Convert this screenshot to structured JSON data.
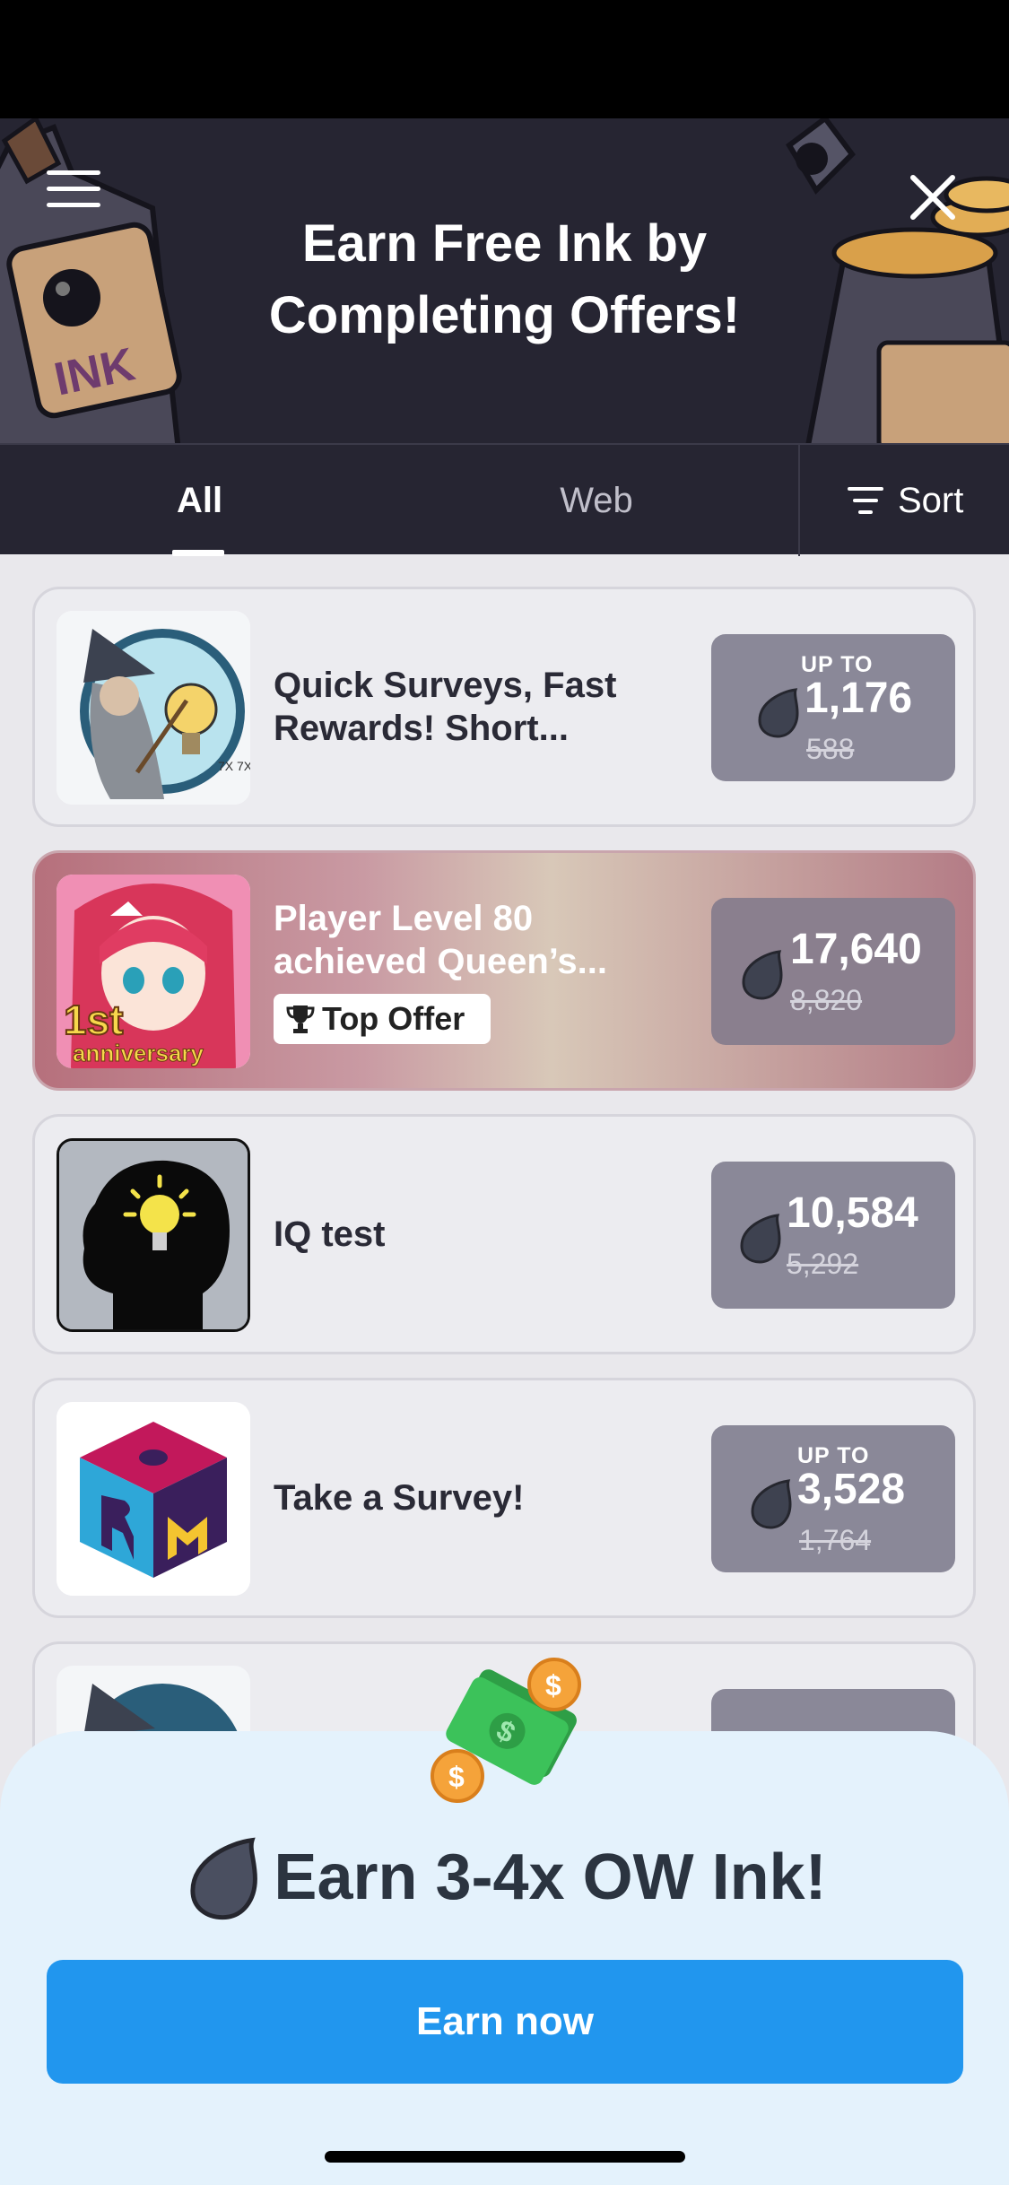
{
  "header": {
    "title_line1": "Earn Free Ink by",
    "title_line2": "Completing Offers!",
    "bottle_label": "INK"
  },
  "tabs": [
    {
      "label": "All",
      "selected": true
    },
    {
      "label": "Web",
      "selected": false
    }
  ],
  "sort_label": "Sort",
  "offers": [
    {
      "title": "Quick Surveys, Fast Rewards! Short...",
      "up_to": "UP TO",
      "value": "1,176",
      "old_value": "588",
      "thumb_text": "7X 7X"
    },
    {
      "title": "Player Level 80 achieved Queen’s...",
      "badge": "Top Offer",
      "value": "17,640",
      "old_value": "8,820",
      "thumb_text_1": "1st",
      "thumb_text_2": "anniversary"
    },
    {
      "title": "IQ test",
      "value": "10,584",
      "old_value": "5,292"
    },
    {
      "title": "Take a Survey!",
      "up_to": "UP TO",
      "value": "3,528",
      "old_value": "1,764"
    }
  ],
  "promo": {
    "text": "Earn 3-4x OW Ink!",
    "button_label": "Earn now"
  },
  "colors": {
    "header_bg": "#262532",
    "reward_bg": "#8a8898",
    "earn_button": "#2196ee",
    "sheet_bg": "#e4f2fc"
  }
}
